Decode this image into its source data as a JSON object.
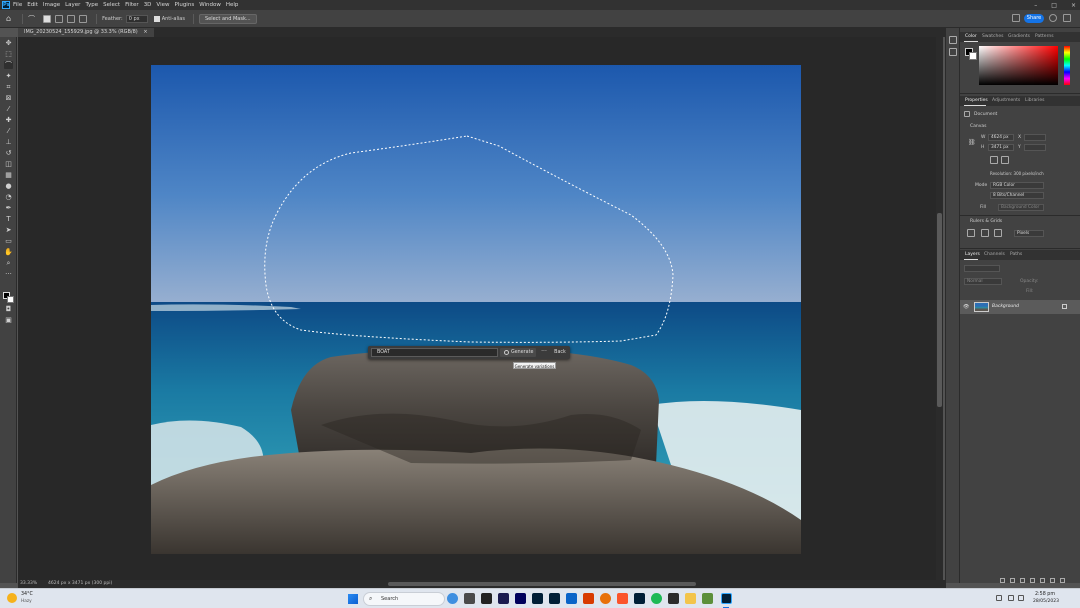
{
  "app": {
    "logo": "Ps",
    "menu": [
      "File",
      "Edit",
      "Image",
      "Layer",
      "Type",
      "Select",
      "Filter",
      "3D",
      "View",
      "Plugins",
      "Window",
      "Help"
    ],
    "window_controls": [
      "–",
      "□",
      "×"
    ]
  },
  "options_bar": {
    "feather_label": "Feather:",
    "feather_value": "0 px",
    "anti_alias_label": "Anti-alias",
    "select_mask_label": "Select and Mask...",
    "share_label": "Share"
  },
  "document": {
    "tab_title": "IMG_20230524_155929.jpg @ 33.3% (RGB/8)",
    "zoom": "33.33%",
    "size_info": "4624 px x 3471 px (300 ppi)"
  },
  "contextual_bar": {
    "prompt_value": "BOAT",
    "generate_label": "Generate",
    "more_label": "···",
    "back_label": "Back",
    "tooltip": "Generate variations"
  },
  "panels": {
    "color_tabs": [
      "Color",
      "Swatches",
      "Gradients",
      "Patterns"
    ],
    "properties_tabs": [
      "Properties",
      "Adjustments",
      "Libraries"
    ],
    "document_label": "Document",
    "canvas_section": "Canvas",
    "width_label": "W",
    "width_value": "4624 px",
    "height_label": "H",
    "height_value": "3471 px",
    "x_label": "X",
    "y_label": "Y",
    "resolution": "Resolution: 300 pixels/inch",
    "mode_label": "Mode",
    "mode_value": "RGB Color",
    "bit_depth": "8 Bits/Channel",
    "fill_label": "Fill",
    "fill_value": "Background Color",
    "rulers_section": "Rulers & Grids",
    "units_value": "Pixels",
    "layers_tabs": [
      "Layers",
      "Channels",
      "Paths"
    ],
    "blend_mode": "Normal",
    "opacity_label": "Opacity:",
    "fill_opacity_label": "Fill:",
    "layer_name": "Background"
  },
  "taskbar": {
    "temperature": "34°C",
    "weather": "Hazy",
    "search_placeholder": "Search",
    "time": "2:58 pm",
    "date": "28/05/2023"
  },
  "colors": {
    "accent": "#1473e6",
    "app_bg": "#424242",
    "canvas_bg": "#282828"
  }
}
